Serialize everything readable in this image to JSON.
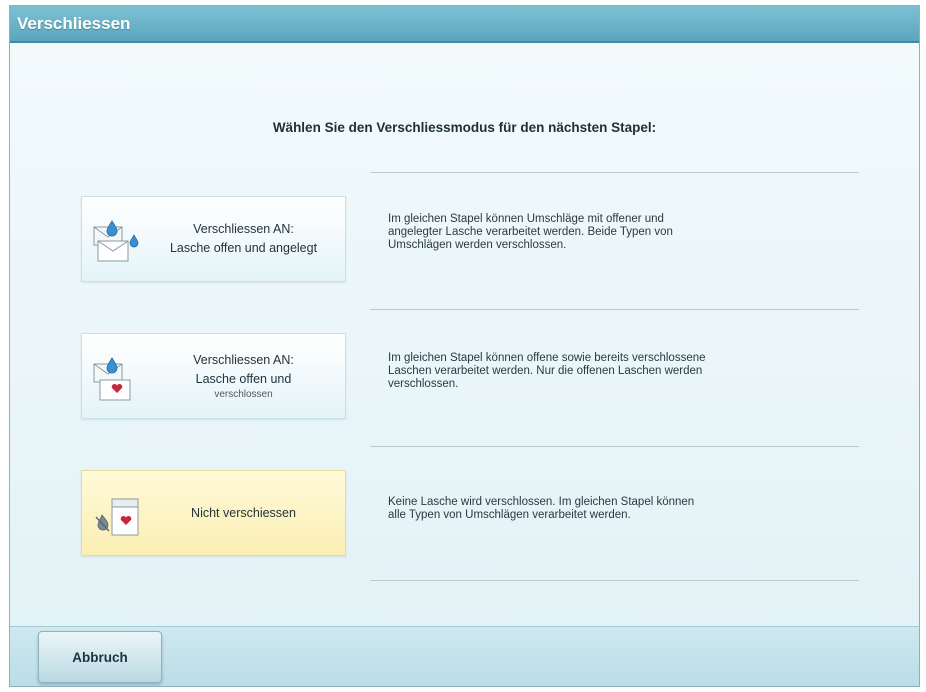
{
  "window": {
    "title": "Verschliessen"
  },
  "instruction": "Wählen Sie den Verschliessmodus für den nächsten Stapel:",
  "options": [
    {
      "id": "seal-open-flap",
      "label_lines": [
        "Verschliessen AN:",
        "Lasche offen und angelegt"
      ],
      "description_lines": [
        "Im gleichen Stapel können Umschläge mit offener und",
        "angelegter Lasche verarbeitet werden. Beide Typen von",
        "Umschlägen werden verschlossen."
      ],
      "icon": "envelope-water-drop-icon",
      "selected": false
    },
    {
      "id": "seal-open-closed",
      "label_lines": [
        "Verschliessen AN:",
        "Lasche offen und",
        "verschlossen"
      ],
      "description_lines": [
        "Im gleichen Stapel können offene sowie bereits verschlossene",
        "Laschen verarbeitet werden. Nur die offenen Laschen werden",
        "verschlossen."
      ],
      "icon": "envelope-drop-heart-icon",
      "selected": false
    },
    {
      "id": "no-seal",
      "label_lines": [
        "Nicht verschiessen"
      ],
      "description_lines": [
        "Keine Lasche wird verschlossen. Im gleichen Stapel können",
        "alle Typen von Umschlägen verarbeitet werden."
      ],
      "icon": "envelope-no-seal-icon",
      "selected": true
    }
  ],
  "footer": {
    "cancel_label": "Abbruch"
  },
  "colors": {
    "title_bar": "#5aa6bd",
    "background": "#e6f4f7",
    "selected_option": "#fbefb4",
    "text": "#24343c"
  }
}
